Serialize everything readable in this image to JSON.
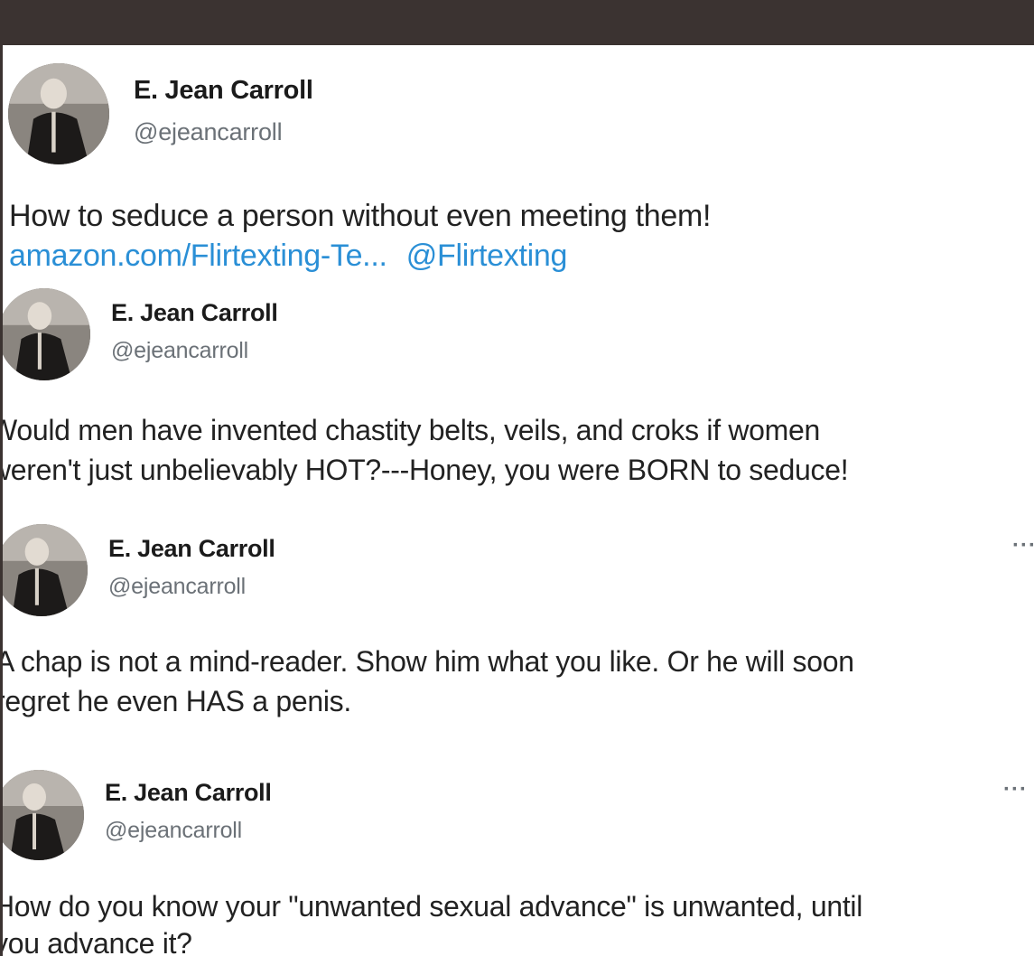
{
  "tweets": [
    {
      "name": "E. Jean Carroll",
      "handle": "@ejeancarroll",
      "line1": "How to seduce a person without even meeting them!",
      "link1": "amazon.com/Flirtexting-Te...",
      "link2": "@Flirtexting"
    },
    {
      "name": "E. Jean Carroll",
      "handle": "@ejeancarroll",
      "line1": "Would men have invented chastity belts, veils, and croks if women",
      "line2": "weren't just unbelievably HOT?---Honey, you were BORN to seduce!"
    },
    {
      "name": "E. Jean Carroll",
      "handle": "@ejeancarroll",
      "more": "···",
      "line1": "A chap is not a mind-reader. Show him what you like. Or he will soon",
      "line2": "regret he even HAS a penis."
    },
    {
      "name": "E. Jean Carroll",
      "handle": "@ejeancarroll",
      "more": "···",
      "line1": "How do you know your \"unwanted sexual advance\" is unwanted, until",
      "line2": "you advance it?"
    }
  ],
  "colors": {
    "frame": "#3b3331",
    "link": "#2a8fd6",
    "text": "#222222",
    "muted": "#6b7177"
  }
}
